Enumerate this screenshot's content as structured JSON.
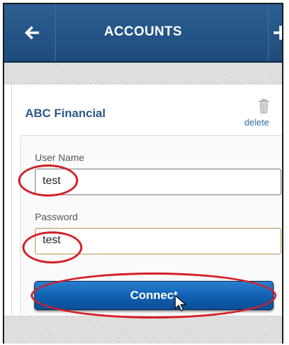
{
  "header": {
    "title": "ACCOUNTS",
    "back_icon": "arrow-left-icon",
    "add_icon": "plus-icon"
  },
  "account": {
    "name": "ABC Financial",
    "delete_label": "delete",
    "delete_icon": "trash-icon"
  },
  "form": {
    "username_label": "User Name",
    "username_value": "test",
    "password_label": "Password",
    "password_value": "test",
    "connect_label": "Connect"
  },
  "colors": {
    "header_bg": "#1e4c7c",
    "accent_link": "#2a5887",
    "button_bg": "#0f5fb1",
    "highlight_ring": "#d41e26",
    "password_border": "#b8924d"
  }
}
